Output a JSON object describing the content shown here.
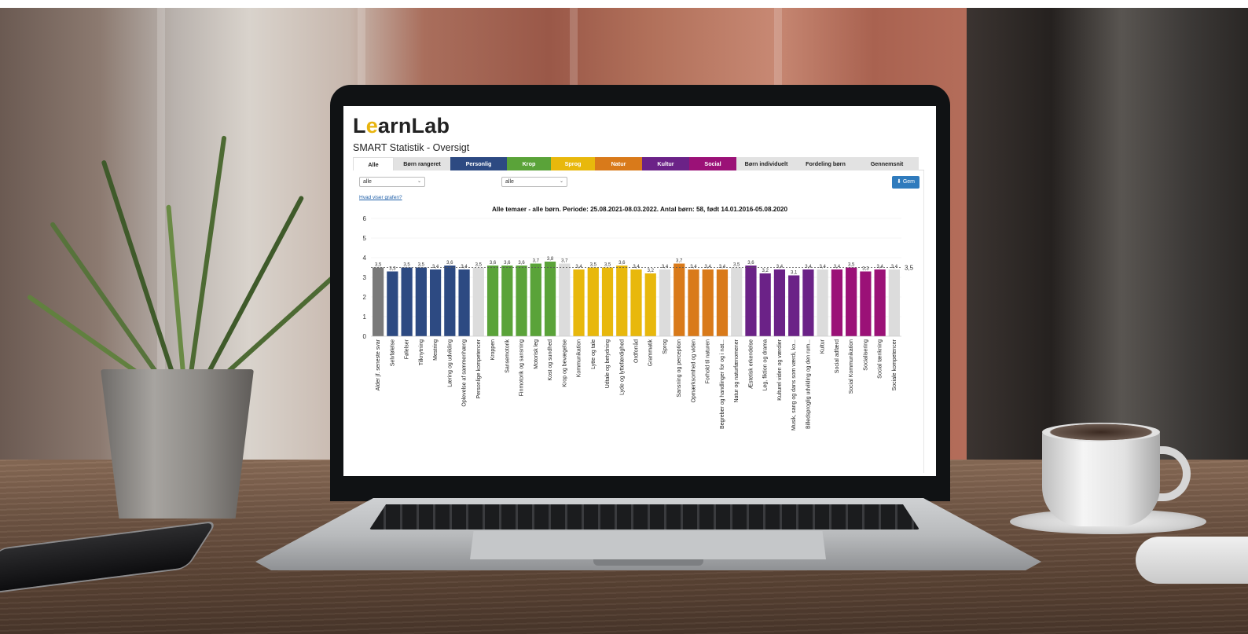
{
  "app": {
    "logo": "LearnLab",
    "page_title": "SMART Statistik - Oversigt"
  },
  "tabs": [
    {
      "label": "Alle",
      "color": "#ffffff",
      "active": true
    },
    {
      "label": "Børn rangeret",
      "color": "#e2e2e2"
    },
    {
      "label": "Personlig",
      "color": "#2d4a82"
    },
    {
      "label": "Krop",
      "color": "#5aa339"
    },
    {
      "label": "Sprog",
      "color": "#e8b80c"
    },
    {
      "label": "Natur",
      "color": "#d97a1a"
    },
    {
      "label": "Kultur",
      "color": "#6b2287"
    },
    {
      "label": "Social",
      "color": "#9b1177"
    },
    {
      "label": "Børn individuelt",
      "color": "#e2e2e2"
    },
    {
      "label": "Fordeling børn",
      "color": "#e2e2e2"
    },
    {
      "label": "Gennemsnit",
      "color": "#e2e2e2"
    }
  ],
  "filters": {
    "select1": "alle",
    "select2": "alle",
    "save_button": "Gem",
    "help_link": "Hvad viser grafen?"
  },
  "chart_data": {
    "type": "bar",
    "title": "Alle temaer - alle børn. Periode: 25.08.2021-08.03.2022. Antal børn: 58, født 14.01.2016-05.08.2020",
    "ylim": [
      0,
      6
    ],
    "yticks": [
      "0",
      "1",
      "2",
      "3",
      "4",
      "5",
      "6"
    ],
    "average_line": {
      "value": 3.5,
      "label": "3,5"
    },
    "grid": true,
    "categories": [
      "Alder jf. seneste svar",
      "Selvfølelse",
      "Følelser",
      "Tilknytning",
      "Mestring",
      "Læring og udvikling",
      "Oplevelse af sammenhæng",
      "Personlige kompetencer",
      "Kroppen",
      "Sansemotorik",
      "Finmotorik og sansning",
      "Motorisk leg",
      "Kost og sundhed",
      "Krop og bevægelse",
      "Kommunikation",
      "Lytte og tale",
      "Udtale og betydning",
      "Lyde og lyttefærdighed",
      "Ordforråd",
      "Grammatik",
      "Sprog",
      "Sansning og perception",
      "Opmærksomhed og viden",
      "Forhold til naturen",
      "Begreber og handlinger for og i nat...",
      "Natur og naturfænomener",
      "Æstetisk erkendelse",
      "Leg, fiktion og drama",
      "Kulturel viden og værdier",
      "Musik, sang og dans som værdi, ko...",
      "Billedsproglig udvikling og den rum...",
      "Kultur",
      "Social adfærd",
      "Social Kommunikation",
      "Socialisering",
      "Social tænkning",
      "Sociale kompetencer"
    ],
    "values": [
      3.5,
      3.3,
      3.5,
      3.5,
      3.4,
      3.6,
      3.4,
      3.5,
      3.6,
      3.6,
      3.6,
      3.7,
      3.8,
      3.7,
      3.4,
      3.5,
      3.5,
      3.6,
      3.4,
      3.2,
      3.4,
      3.7,
      3.4,
      3.4,
      3.4,
      3.5,
      3.6,
      3.2,
      3.4,
      3.1,
      3.4,
      3.4,
      3.4,
      3.5,
      3.3,
      3.4,
      3.4
    ],
    "value_labels": [
      "3,5",
      "3,3",
      "3,5",
      "3,5",
      "3,4",
      "3,6",
      "3,4",
      "3,5",
      "3,6",
      "3,6",
      "3,6",
      "3,7",
      "3,8",
      "3,7",
      "3,4",
      "3,5",
      "3,5",
      "3,6",
      "3,4",
      "3,2",
      "3,4",
      "3,7",
      "3,4",
      "3,4",
      "3,4",
      "3,5",
      "3,6",
      "3,2",
      "3,4",
      "3,1",
      "3,4",
      "3,4",
      "3,4",
      "3,5",
      "3,3",
      "3,4",
      "3,4"
    ],
    "bar_colors": [
      "#7a7a7a",
      "#2d4a82",
      "#2d4a82",
      "#2d4a82",
      "#2d4a82",
      "#2d4a82",
      "#2d4a82",
      "#dcdcdc",
      "#5aa339",
      "#5aa339",
      "#5aa339",
      "#5aa339",
      "#5aa339",
      "#dcdcdc",
      "#e8b80c",
      "#e8b80c",
      "#e8b80c",
      "#e8b80c",
      "#e8b80c",
      "#e8b80c",
      "#dcdcdc",
      "#d97a1a",
      "#d97a1a",
      "#d97a1a",
      "#d97a1a",
      "#dcdcdc",
      "#6b2287",
      "#6b2287",
      "#6b2287",
      "#6b2287",
      "#6b2287",
      "#dcdcdc",
      "#9b1177",
      "#9b1177",
      "#9b1177",
      "#9b1177",
      "#dcdcdc"
    ]
  }
}
